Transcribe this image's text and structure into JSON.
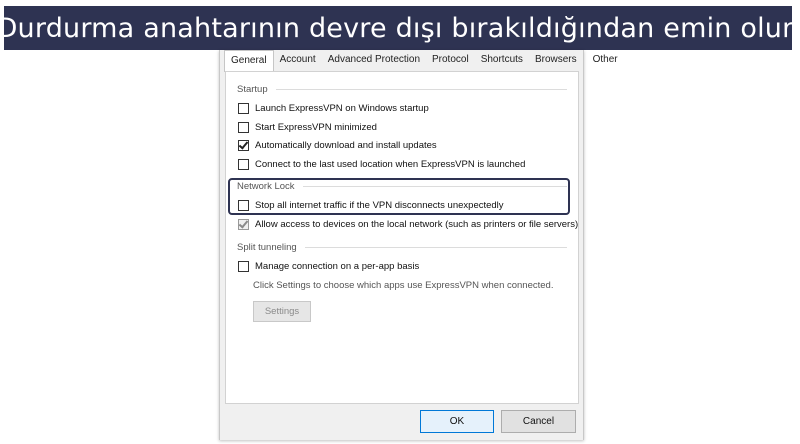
{
  "banner": {
    "text": "Durdurma anahtarının devre dışı bırakıldığından emin olun"
  },
  "tabs": [
    {
      "label": "General",
      "active": true
    },
    {
      "label": "Account"
    },
    {
      "label": "Advanced Protection"
    },
    {
      "label": "Protocol"
    },
    {
      "label": "Shortcuts"
    },
    {
      "label": "Browsers"
    },
    {
      "label": "Other"
    }
  ],
  "startup": {
    "title": "Startup",
    "options": [
      {
        "label": "Launch ExpressVPN on Windows startup",
        "checked": false
      },
      {
        "label": "Start ExpressVPN minimized",
        "checked": false
      },
      {
        "label": "Automatically download and install updates",
        "checked": true
      },
      {
        "label": "Connect to the last used location when ExpressVPN is launched",
        "checked": false
      }
    ]
  },
  "network_lock": {
    "title": "Network Lock",
    "stop_traffic": {
      "label": "Stop all internet traffic if the VPN disconnects unexpectedly",
      "checked": false
    },
    "allow_local": {
      "label": "Allow access to devices on the local network (such as printers or file servers)",
      "checked": true,
      "disabled": true
    }
  },
  "split_tunneling": {
    "title": "Split tunneling",
    "per_app": {
      "label": "Manage connection on a per-app basis",
      "checked": false
    },
    "hint": "Click Settings to choose which apps use ExpressVPN when connected.",
    "settings_button": "Settings"
  },
  "footer": {
    "ok": "OK",
    "cancel": "Cancel"
  }
}
